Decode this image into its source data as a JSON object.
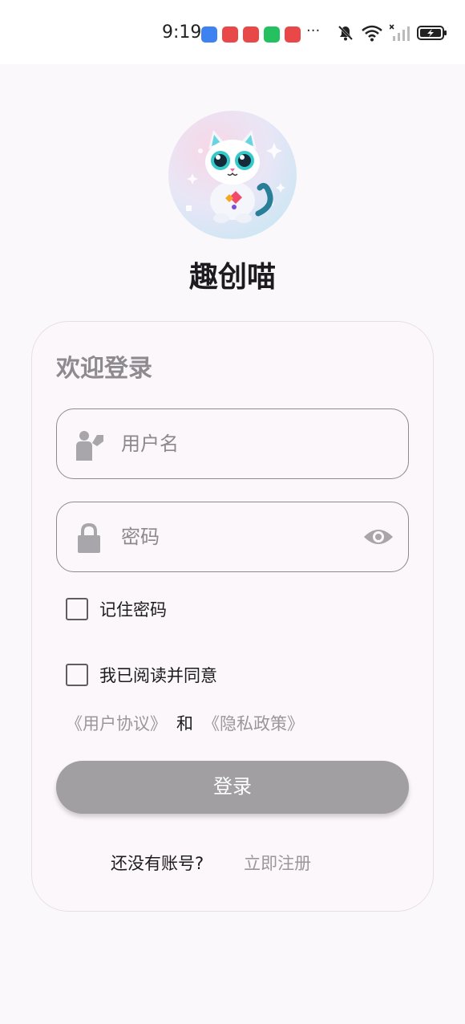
{
  "status_bar": {
    "time": "9:19",
    "notification_icons": [
      "alipay-icon",
      "app-red-icon",
      "app-red-icon",
      "wechat-icon",
      "app-red-icon"
    ],
    "more": "···",
    "system_icons": [
      "mute-icon",
      "wifi-icon",
      "signal-icon",
      "battery-charging-icon"
    ],
    "colors": {
      "blue": "#3d82f0",
      "red": "#e94848",
      "green": "#25c160"
    }
  },
  "app": {
    "name": "趣创喵",
    "logo": "cat-mascot-logo"
  },
  "login_card": {
    "title": "欢迎登录",
    "username": {
      "placeholder": "用户名",
      "value": "",
      "icon": "user-icon"
    },
    "password": {
      "placeholder": "密码",
      "value": "",
      "icon": "lock-icon",
      "toggle_icon": "eye-icon"
    },
    "remember_label": "记住密码",
    "remember_checked": false,
    "agree_label": "我已阅读并同意",
    "agree_checked": false,
    "user_agreement": "《用户协议》",
    "and_text": "和",
    "privacy_policy": "《隐私政策》",
    "login_button": "登录",
    "no_account": "还没有账号?",
    "register_link": "立即注册"
  },
  "colors": {
    "background": "#fbf8fb",
    "card": "#fcf7fb",
    "button": "#a19fa2",
    "muted_text": "#9a969c"
  }
}
